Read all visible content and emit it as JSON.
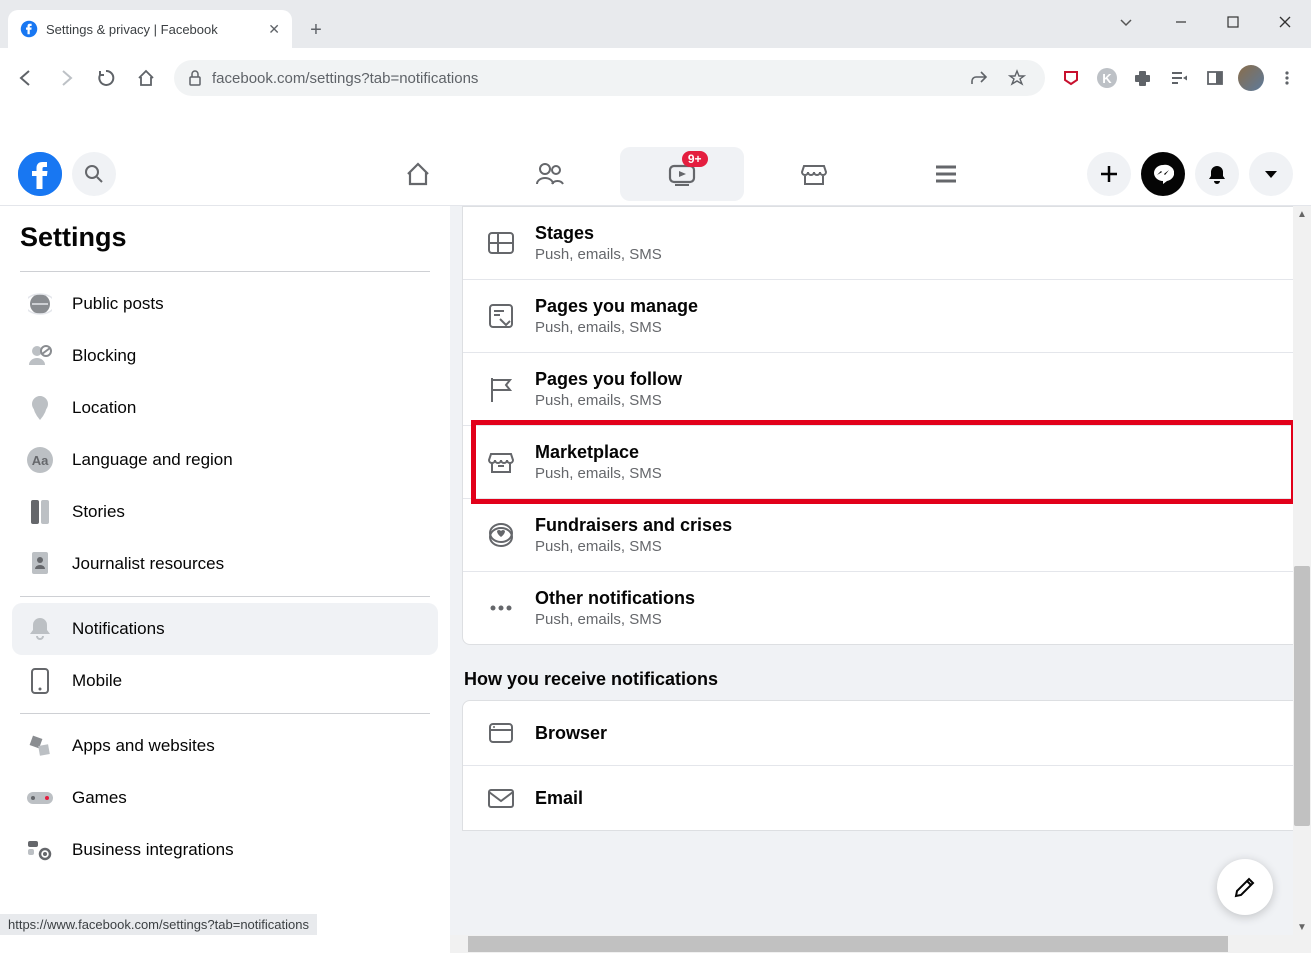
{
  "browser": {
    "tab_title": "Settings & privacy | Facebook",
    "url": "facebook.com/settings?tab=notifications",
    "status_url": "https://www.facebook.com/settings?tab=notifications"
  },
  "fb_header": {
    "watch_badge": "9+"
  },
  "sidebar": {
    "heading": "Settings",
    "items_a": [
      "Public posts",
      "Blocking",
      "Location",
      "Language and region",
      "Stories",
      "Journalist resources"
    ],
    "items_b": [
      "Notifications",
      "Mobile"
    ],
    "items_c": [
      "Apps and websites",
      "Games",
      "Business integrations"
    ],
    "selected": "Notifications"
  },
  "notif_rows": [
    {
      "title": "Stages",
      "sub": "Push, emails, SMS",
      "icon": "grid"
    },
    {
      "title": "Pages you manage",
      "sub": "Push, emails, SMS",
      "icon": "page-manage"
    },
    {
      "title": "Pages you follow",
      "sub": "Push, emails, SMS",
      "icon": "flag"
    },
    {
      "title": "Marketplace",
      "sub": "Push, emails, SMS",
      "icon": "shop",
      "highlighted": true
    },
    {
      "title": "Fundraisers and crises",
      "sub": "Push, emails, SMS",
      "icon": "heart-coin"
    },
    {
      "title": "Other notifications",
      "sub": "Push, emails, SMS",
      "icon": "dots"
    }
  ],
  "section_heading": "How you receive notifications",
  "receive_rows": [
    {
      "title": "Browser",
      "icon": "window"
    },
    {
      "title": "Email",
      "icon": "mail"
    }
  ]
}
